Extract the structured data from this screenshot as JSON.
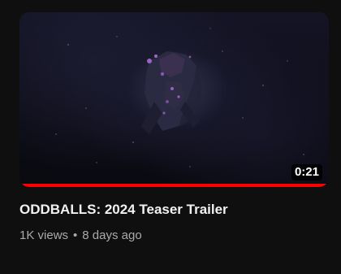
{
  "video": {
    "title": "ODDBALLS: 2024 Teaser Trailer",
    "duration": "0:21",
    "views": "1K views",
    "separator": "•",
    "age": "8 days ago",
    "watch_progress": 1.0
  },
  "colors": {
    "background": "#0f0f0f",
    "progress": "#ff0000",
    "title_text": "#f1f1f1",
    "meta_text": "#aaaaaa"
  }
}
